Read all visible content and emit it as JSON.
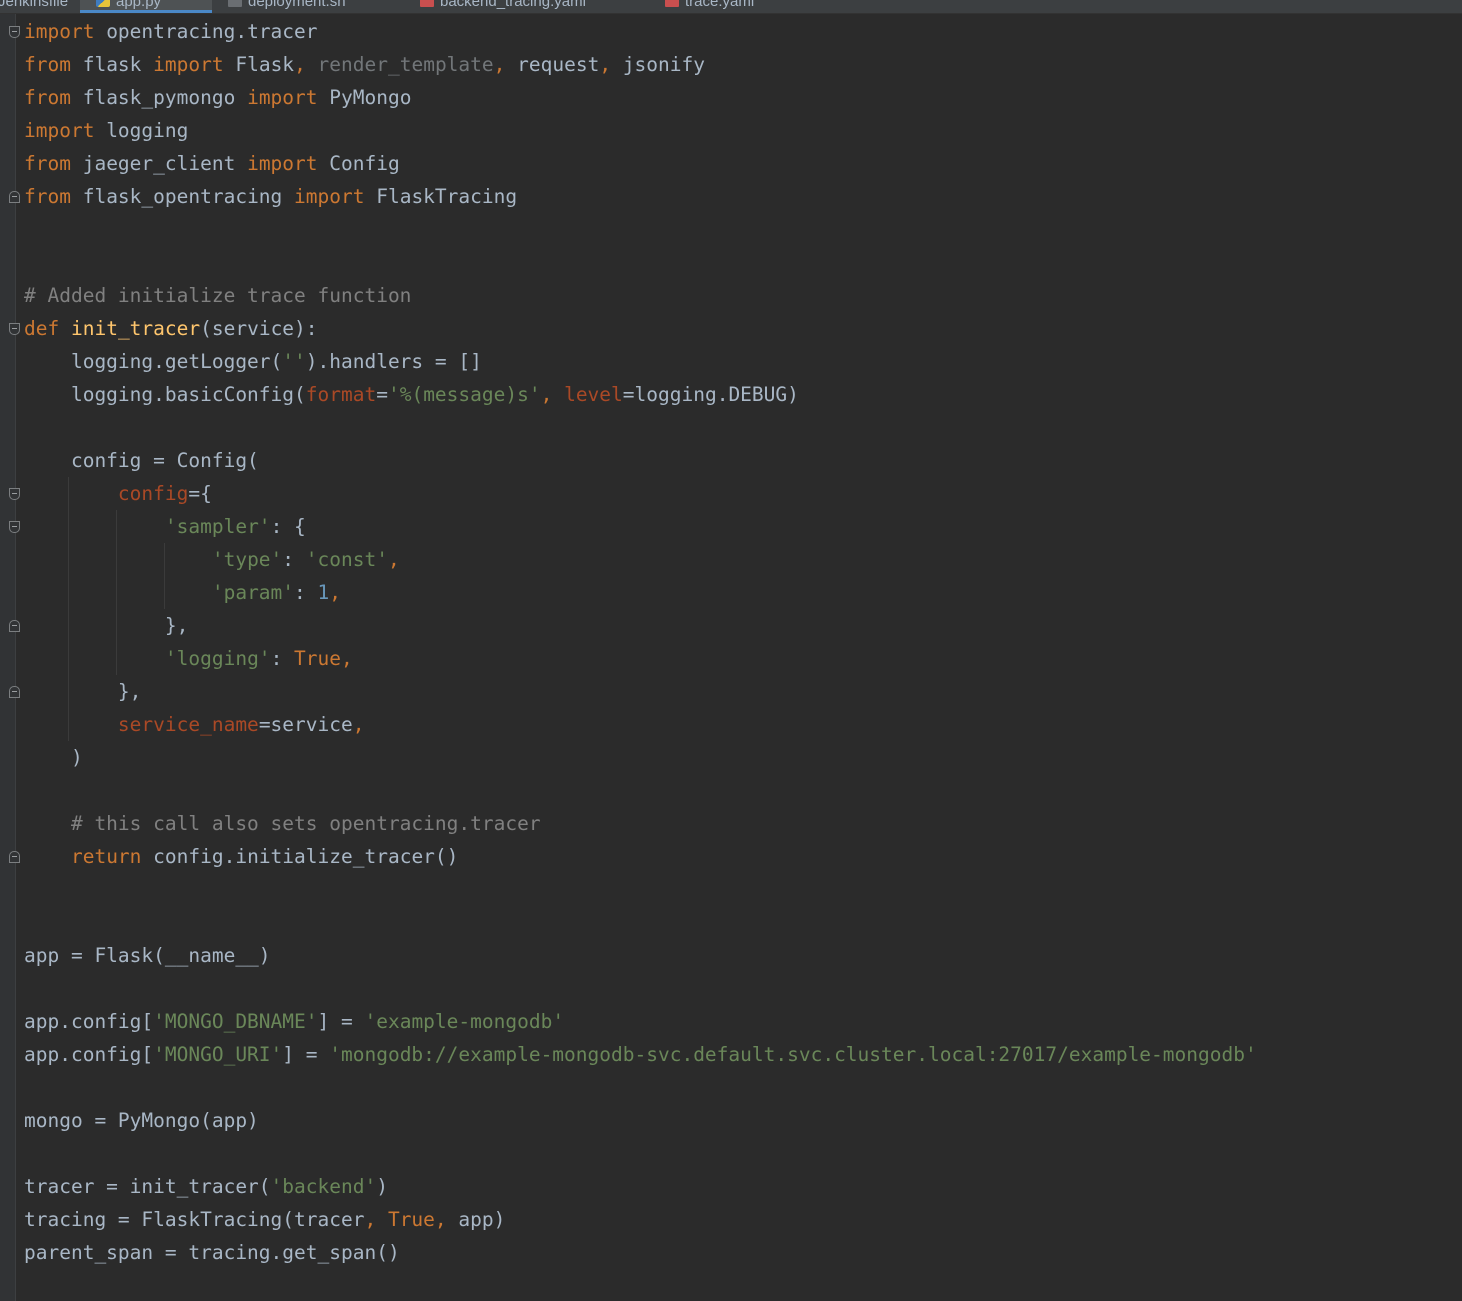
{
  "tabs": [
    {
      "label": "Jenkinsfile",
      "icon": "file-icon",
      "active": false
    },
    {
      "label": "app.py",
      "icon": "python-file-icon",
      "active": true
    },
    {
      "label": "deployment.sh",
      "icon": "shell-file-icon",
      "active": false
    },
    {
      "label": "backend_tracing.yaml",
      "icon": "yaml-file-icon",
      "active": false
    },
    {
      "label": "trace.yaml",
      "icon": "yaml-file-icon",
      "active": false
    }
  ],
  "colors": {
    "background": "#2b2b2b",
    "keyword": "#cc7832",
    "string": "#6a8759",
    "number": "#6897bb",
    "comment": "#808080",
    "function": "#ffc66d",
    "parameter": "#aa4926",
    "text": "#a9b7c6"
  },
  "code": {
    "l01": [
      "import",
      " opentracing.tracer"
    ],
    "l02": [
      "from",
      " flask ",
      "import",
      " Flask",
      ", ",
      "render_template",
      ", ",
      "request",
      ", ",
      "jsonify"
    ],
    "l03": [
      "from",
      " flask_pymongo ",
      "import",
      " PyMongo"
    ],
    "l04": [
      "import",
      " logging"
    ],
    "l05": [
      "from",
      " jaeger_client ",
      "import",
      " Config"
    ],
    "l06": [
      "from",
      " flask_opentracing ",
      "import",
      " FlaskTracing"
    ],
    "l09": [
      "# Added initialize trace function"
    ],
    "l10": [
      "def",
      " ",
      "init_tracer",
      "(service):"
    ],
    "l11": [
      "    logging.getLogger(",
      "''",
      ").handlers = []"
    ],
    "l12": [
      "    logging.basicConfig(",
      "format",
      "=",
      "'%(message)s'",
      ", ",
      "level",
      "=logging.DEBUG)"
    ],
    "l14": [
      "    config = Config("
    ],
    "l15": [
      "        ",
      "config",
      "={"
    ],
    "l16": [
      "            ",
      "'sampler'",
      ": {"
    ],
    "l17": [
      "                ",
      "'type'",
      ": ",
      "'const'",
      ","
    ],
    "l18": [
      "                ",
      "'param'",
      ": ",
      "1",
      ","
    ],
    "l19": [
      "            },"
    ],
    "l20": [
      "            ",
      "'logging'",
      ": ",
      "True",
      ","
    ],
    "l21": [
      "        },"
    ],
    "l22": [
      "        ",
      "service_name",
      "=service",
      ","
    ],
    "l23": [
      "    )"
    ],
    "l25": [
      "    # this call also sets opentracing.tracer"
    ],
    "l26": [
      "    ",
      "return",
      " config.initialize_tracer()"
    ],
    "l29": [
      "app = Flask(__name__)"
    ],
    "l31": [
      "app.config[",
      "'MONGO_DBNAME'",
      "] = ",
      "'example-mongodb'"
    ],
    "l32": [
      "app.config[",
      "'MONGO_URI'",
      "] = ",
      "'mongodb://example-mongodb-svc.default.svc.cluster.local:27017/example-mongodb'"
    ],
    "l34": [
      "mongo = PyMongo(app)"
    ],
    "l36": [
      "tracer = init_tracer(",
      "'backend'",
      ")"
    ],
    "l37": [
      "tracing = FlaskTracing(tracer",
      ", ",
      "True",
      ", ",
      "app)"
    ],
    "l38": [
      "parent_span = tracing.get_span()"
    ]
  }
}
